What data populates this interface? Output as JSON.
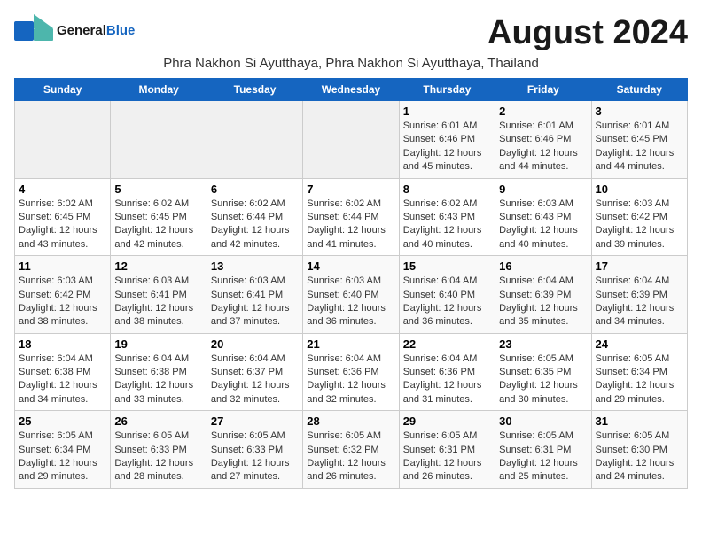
{
  "logo": {
    "general": "General",
    "blue": "Blue"
  },
  "month_title": "August 2024",
  "subtitle": "Phra Nakhon Si Ayutthaya, Phra Nakhon Si Ayutthaya, Thailand",
  "days_of_week": [
    "Sunday",
    "Monday",
    "Tuesday",
    "Wednesday",
    "Thursday",
    "Friday",
    "Saturday"
  ],
  "weeks": [
    [
      {
        "day": "",
        "info": ""
      },
      {
        "day": "",
        "info": ""
      },
      {
        "day": "",
        "info": ""
      },
      {
        "day": "",
        "info": ""
      },
      {
        "day": "1",
        "info": "Sunrise: 6:01 AM\nSunset: 6:46 PM\nDaylight: 12 hours and 45 minutes."
      },
      {
        "day": "2",
        "info": "Sunrise: 6:01 AM\nSunset: 6:46 PM\nDaylight: 12 hours and 44 minutes."
      },
      {
        "day": "3",
        "info": "Sunrise: 6:01 AM\nSunset: 6:45 PM\nDaylight: 12 hours and 44 minutes."
      }
    ],
    [
      {
        "day": "4",
        "info": "Sunrise: 6:02 AM\nSunset: 6:45 PM\nDaylight: 12 hours and 43 minutes."
      },
      {
        "day": "5",
        "info": "Sunrise: 6:02 AM\nSunset: 6:45 PM\nDaylight: 12 hours and 42 minutes."
      },
      {
        "day": "6",
        "info": "Sunrise: 6:02 AM\nSunset: 6:44 PM\nDaylight: 12 hours and 42 minutes."
      },
      {
        "day": "7",
        "info": "Sunrise: 6:02 AM\nSunset: 6:44 PM\nDaylight: 12 hours and 41 minutes."
      },
      {
        "day": "8",
        "info": "Sunrise: 6:02 AM\nSunset: 6:43 PM\nDaylight: 12 hours and 40 minutes."
      },
      {
        "day": "9",
        "info": "Sunrise: 6:03 AM\nSunset: 6:43 PM\nDaylight: 12 hours and 40 minutes."
      },
      {
        "day": "10",
        "info": "Sunrise: 6:03 AM\nSunset: 6:42 PM\nDaylight: 12 hours and 39 minutes."
      }
    ],
    [
      {
        "day": "11",
        "info": "Sunrise: 6:03 AM\nSunset: 6:42 PM\nDaylight: 12 hours and 38 minutes."
      },
      {
        "day": "12",
        "info": "Sunrise: 6:03 AM\nSunset: 6:41 PM\nDaylight: 12 hours and 38 minutes."
      },
      {
        "day": "13",
        "info": "Sunrise: 6:03 AM\nSunset: 6:41 PM\nDaylight: 12 hours and 37 minutes."
      },
      {
        "day": "14",
        "info": "Sunrise: 6:03 AM\nSunset: 6:40 PM\nDaylight: 12 hours and 36 minutes."
      },
      {
        "day": "15",
        "info": "Sunrise: 6:04 AM\nSunset: 6:40 PM\nDaylight: 12 hours and 36 minutes."
      },
      {
        "day": "16",
        "info": "Sunrise: 6:04 AM\nSunset: 6:39 PM\nDaylight: 12 hours and 35 minutes."
      },
      {
        "day": "17",
        "info": "Sunrise: 6:04 AM\nSunset: 6:39 PM\nDaylight: 12 hours and 34 minutes."
      }
    ],
    [
      {
        "day": "18",
        "info": "Sunrise: 6:04 AM\nSunset: 6:38 PM\nDaylight: 12 hours and 34 minutes."
      },
      {
        "day": "19",
        "info": "Sunrise: 6:04 AM\nSunset: 6:38 PM\nDaylight: 12 hours and 33 minutes."
      },
      {
        "day": "20",
        "info": "Sunrise: 6:04 AM\nSunset: 6:37 PM\nDaylight: 12 hours and 32 minutes."
      },
      {
        "day": "21",
        "info": "Sunrise: 6:04 AM\nSunset: 6:36 PM\nDaylight: 12 hours and 32 minutes."
      },
      {
        "day": "22",
        "info": "Sunrise: 6:04 AM\nSunset: 6:36 PM\nDaylight: 12 hours and 31 minutes."
      },
      {
        "day": "23",
        "info": "Sunrise: 6:05 AM\nSunset: 6:35 PM\nDaylight: 12 hours and 30 minutes."
      },
      {
        "day": "24",
        "info": "Sunrise: 6:05 AM\nSunset: 6:34 PM\nDaylight: 12 hours and 29 minutes."
      }
    ],
    [
      {
        "day": "25",
        "info": "Sunrise: 6:05 AM\nSunset: 6:34 PM\nDaylight: 12 hours and 29 minutes."
      },
      {
        "day": "26",
        "info": "Sunrise: 6:05 AM\nSunset: 6:33 PM\nDaylight: 12 hours and 28 minutes."
      },
      {
        "day": "27",
        "info": "Sunrise: 6:05 AM\nSunset: 6:33 PM\nDaylight: 12 hours and 27 minutes."
      },
      {
        "day": "28",
        "info": "Sunrise: 6:05 AM\nSunset: 6:32 PM\nDaylight: 12 hours and 26 minutes."
      },
      {
        "day": "29",
        "info": "Sunrise: 6:05 AM\nSunset: 6:31 PM\nDaylight: 12 hours and 26 minutes."
      },
      {
        "day": "30",
        "info": "Sunrise: 6:05 AM\nSunset: 6:31 PM\nDaylight: 12 hours and 25 minutes."
      },
      {
        "day": "31",
        "info": "Sunrise: 6:05 AM\nSunset: 6:30 PM\nDaylight: 12 hours and 24 minutes."
      }
    ]
  ]
}
